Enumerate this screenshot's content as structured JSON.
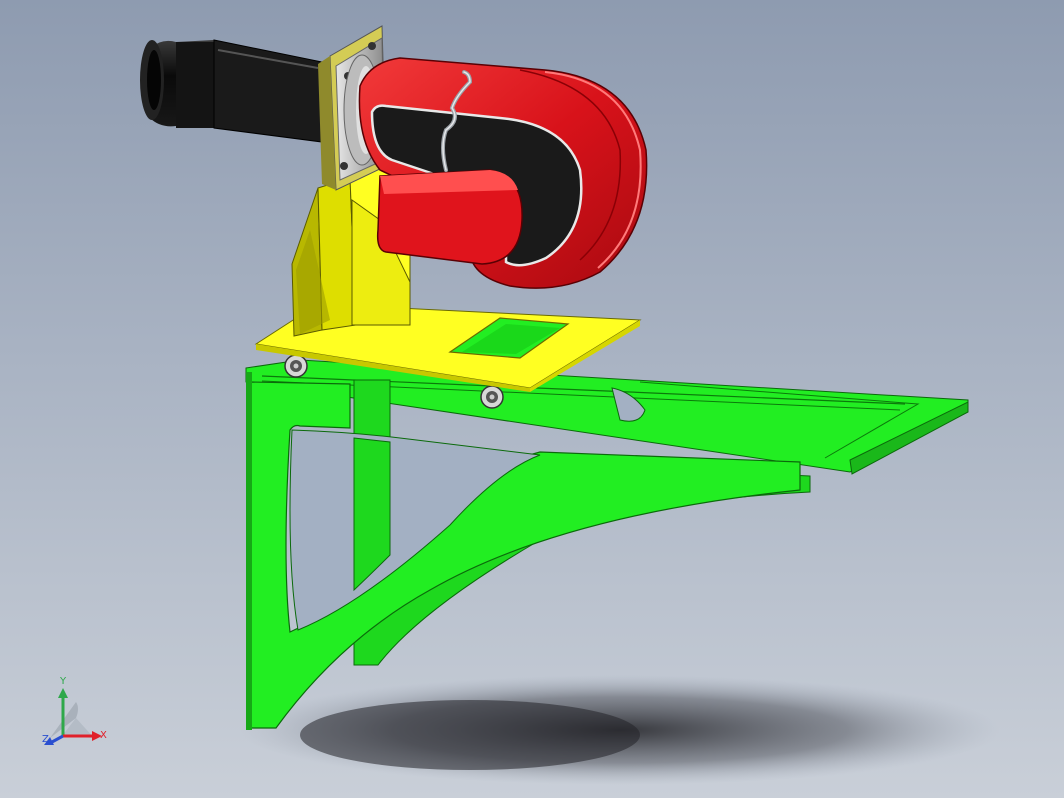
{
  "triad": {
    "x_label": "X",
    "y_label": "Y",
    "z_label": "Z",
    "x_color": "#e0202a",
    "y_color": "#2ea84a",
    "z_color": "#2a4fd0"
  },
  "model_colors": {
    "bracket": "#22ee22",
    "plate": "#ffff22",
    "burner_housing": "#e8141a",
    "blast_tube": "#111111",
    "flange": "#c8c8c8"
  }
}
